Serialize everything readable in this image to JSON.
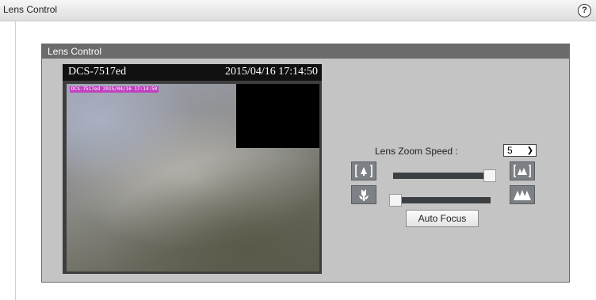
{
  "outer": {
    "title": "Lens Control",
    "help": "?"
  },
  "panel": {
    "title": "Lens Control"
  },
  "video": {
    "camera_name": "DCS-7517ed",
    "timestamp": "2015/04/16 17:14:50",
    "osd_text": "DCS-7517ed 2015/04/16 17:14:50"
  },
  "controls": {
    "zoom_speed_label": "Lens Zoom Speed :",
    "zoom_speed_value": "5",
    "zoom_slider_level": 1.0,
    "focus_slider_level": 0.0,
    "auto_focus_label": "Auto Focus"
  },
  "icons": {
    "zoom_tele": "zoom-in-icon",
    "zoom_wide": "zoom-out-icon",
    "focus_near": "flower-icon",
    "focus_far": "mountain-icon"
  }
}
